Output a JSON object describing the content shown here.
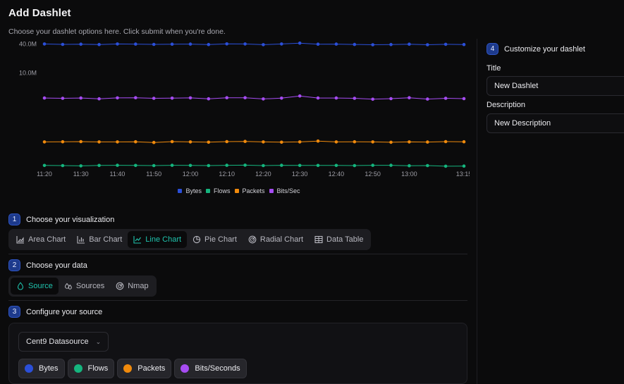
{
  "header": {
    "title": "Add Dashlet",
    "subtitle": "Choose your dashlet options here. Click submit when you're done."
  },
  "chart_data": {
    "type": "line",
    "y_scale": "log",
    "y_tick_labels": [
      "40.0M",
      "10.0M"
    ],
    "categories": [
      "11:20",
      "11:25",
      "11:30",
      "11:35",
      "11:40",
      "11:45",
      "11:50",
      "11:55",
      "12:00",
      "12:05",
      "12:10",
      "12:15",
      "12:20",
      "12:25",
      "12:30",
      "12:35",
      "12:40",
      "12:45",
      "12:50",
      "12:55",
      "13:00",
      "13:05",
      "13:10",
      "13:15"
    ],
    "x_tick_labels": [
      "11:20",
      "11:30",
      "11:40",
      "11:50",
      "12:00",
      "12:10",
      "12:20",
      "12:30",
      "12:40",
      "12:50",
      "13:00",
      "13:15"
    ],
    "series": [
      {
        "name": "Bytes",
        "color": "#2b4fd8",
        "values": [
          40000000,
          39000000,
          39500000,
          38500000,
          40000000,
          39800000,
          39000000,
          39500000,
          39800000,
          38500000,
          40200000,
          40000000,
          38200000,
          40000000,
          42500000,
          39500000,
          39800000,
          38800000,
          38000000,
          38600000,
          39500000,
          38000000,
          39200000,
          38500000
        ]
      },
      {
        "name": "Flows",
        "color": "#15b57e",
        "values": [
          10000,
          9900,
          9700,
          10000,
          10100,
          10000,
          9900,
          10100,
          10000,
          9900,
          10100,
          10200,
          9900,
          10100,
          10000,
          10000,
          10000,
          9900,
          10100,
          10100,
          9800,
          9900,
          9500,
          9600
        ]
      },
      {
        "name": "Packets",
        "color": "#f08a0c",
        "values": [
          50000,
          50500,
          51000,
          50000,
          50000,
          50500,
          48000,
          50800,
          50000,
          48900,
          51000,
          51500,
          50000,
          49000,
          50000,
          53000,
          50000,
          50500,
          50000,
          48800,
          50000,
          49500,
          51000,
          50500
        ]
      },
      {
        "name": "Bits/Sec",
        "color": "#a64cf2",
        "values": [
          1000000,
          980000,
          1000000,
          950000,
          1010000,
          1020000,
          980000,
          990000,
          1010000,
          950000,
          1020000,
          1020000,
          940000,
          990000,
          1150000,
          1000000,
          1000000,
          980000,
          920000,
          960000,
          1020000,
          930000,
          980000,
          960000
        ]
      }
    ]
  },
  "steps": {
    "s1": {
      "num": "1",
      "label": "Choose your visualization"
    },
    "s2": {
      "num": "2",
      "label": "Choose your data"
    },
    "s3": {
      "num": "3",
      "label": "Configure your source"
    },
    "s4": {
      "num": "4",
      "label": "Customize your dashlet"
    }
  },
  "viz_options": [
    {
      "label": "Area Chart",
      "icon": "area-chart-icon",
      "active": false
    },
    {
      "label": "Bar Chart",
      "icon": "bar-chart-icon",
      "active": false
    },
    {
      "label": "Line Chart",
      "icon": "line-chart-icon",
      "active": true
    },
    {
      "label": "Pie Chart",
      "icon": "pie-chart-icon",
      "active": false
    },
    {
      "label": "Radial Chart",
      "icon": "radial-chart-icon",
      "active": false
    },
    {
      "label": "Data Table",
      "icon": "table-icon",
      "active": false
    }
  ],
  "data_options": [
    {
      "label": "Source",
      "icon": "droplet-icon",
      "active": true
    },
    {
      "label": "Sources",
      "icon": "droplets-icon",
      "active": false
    },
    {
      "label": "Nmap",
      "icon": "radar-icon",
      "active": false
    }
  ],
  "source": {
    "selected": "Cent9 Datasource",
    "metrics": [
      {
        "label": "Bytes",
        "color": "#2b4fd8"
      },
      {
        "label": "Flows",
        "color": "#15b57e"
      },
      {
        "label": "Packets",
        "color": "#f08a0c"
      },
      {
        "label": "Bits/Seconds",
        "color": "#a64cf2"
      }
    ]
  },
  "customize": {
    "title_label": "Title",
    "title_value": "New Dashlet",
    "description_label": "Description",
    "description_value": "New Description"
  },
  "colors": {
    "accent": "#1fc3ad",
    "step_badge": "#1d3a8c",
    "background": "#0b0b0c"
  }
}
